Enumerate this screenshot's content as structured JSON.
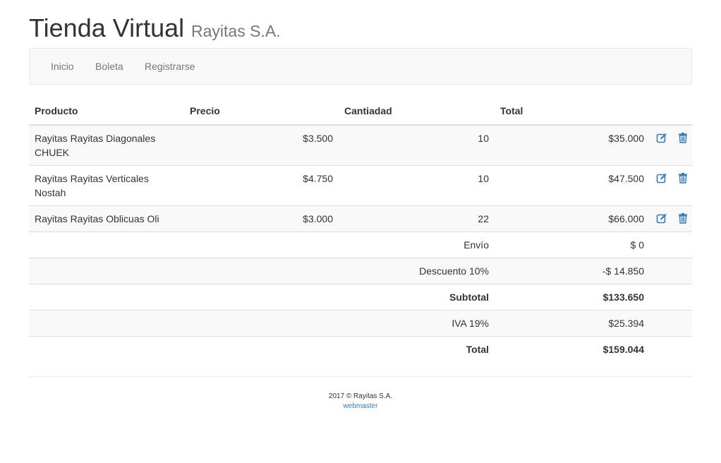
{
  "header": {
    "title": "Tienda Virtual",
    "subtitle": "Rayitas S.A."
  },
  "nav": {
    "items": [
      {
        "label": "Inicio"
      },
      {
        "label": "Boleta"
      },
      {
        "label": "Registrarse"
      }
    ]
  },
  "table": {
    "headers": [
      "Producto",
      "Precio",
      "Cantiadad",
      "Total"
    ],
    "rows": [
      {
        "product": "Rayitas Rayitas Diagonales CHUEK",
        "price": "$3.500",
        "quantity": "10",
        "total": "$35.000"
      },
      {
        "product": "Rayitas Rayitas Verticales Nostah",
        "price": "$4.750",
        "quantity": "10",
        "total": "$47.500"
      },
      {
        "product": "Rayitas Rayitas Oblicuas Oli",
        "price": "$3.000",
        "quantity": "22",
        "total": "$66.000"
      }
    ],
    "summary": [
      {
        "label": "Envío",
        "value": "$ 0"
      },
      {
        "label": "Descuento 10%",
        "value": "-$ 14.850"
      },
      {
        "label": "Subtotal",
        "value": "$133.650"
      },
      {
        "label": "IVA 19%",
        "value": "$25.394"
      },
      {
        "label": "Total",
        "value": "$159.044"
      }
    ],
    "icons": {
      "edit": "edit-icon",
      "delete": "trash-icon"
    }
  },
  "footer": {
    "copyright": "2017 © Rayitas S.A.",
    "link": "webmaster"
  },
  "colors": {
    "link": "#337ab7",
    "discount": "#e60000",
    "navbar_bg": "#f8f8f8",
    "stripe": "#f9f9f9"
  }
}
